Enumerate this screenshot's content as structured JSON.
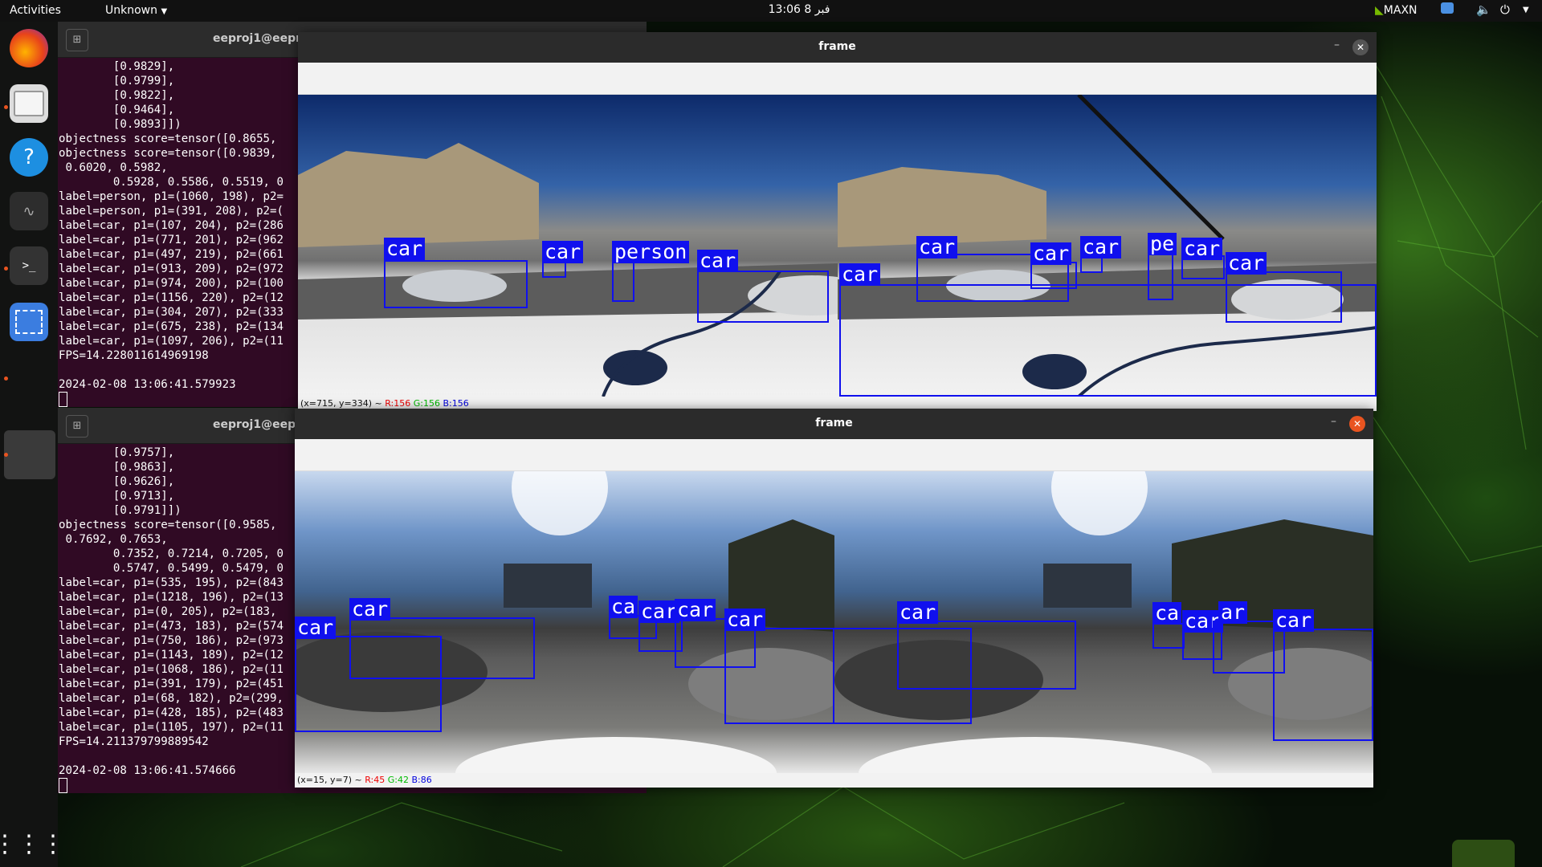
{
  "topbar": {
    "activities": "Activities",
    "app_menu": "Unknown",
    "clock": "13:06  فبر 8",
    "maxn": "MAXN",
    "icons": [
      "nvidia-icon",
      "network-icon",
      "volume-icon",
      "power-icon",
      "chevron-down-icon"
    ]
  },
  "dock": {
    "apps": [
      "firefox",
      "files",
      "help",
      "system-monitor",
      "terminal",
      "screenshot",
      "window",
      "show-apps"
    ]
  },
  "terminal_top": {
    "title": "eeproj1@eepro",
    "lines": [
      "        [0.9829],",
      "        [0.9799],",
      "        [0.9822],",
      "        [0.9464],",
      "        [0.9893]])",
      "objectness score=tensor([0.8655,",
      "objectness score=tensor([0.9839,",
      " 0.6020, 0.5982,",
      "        0.5928, 0.5586, 0.5519, 0",
      "label=person, p1=(1060, 198), p2=",
      "label=person, p1=(391, 208), p2=(",
      "label=car, p1=(107, 204), p2=(286",
      "label=car, p1=(771, 201), p2=(962",
      "label=car, p1=(497, 219), p2=(661",
      "label=car, p1=(913, 209), p2=(972",
      "label=car, p1=(974, 200), p2=(100",
      "label=car, p1=(1156, 220), p2=(12",
      "label=car, p1=(304, 207), p2=(333",
      "label=car, p1=(675, 238), p2=(134",
      "label=car, p1=(1097, 206), p2=(11",
      "FPS=14.228011614969198",
      "",
      "2024-02-08 13:06:41.579923"
    ]
  },
  "terminal_bottom": {
    "title": "eeproj1@eepr",
    "lines": [
      "        [0.9757],",
      "        [0.9863],",
      "        [0.9626],",
      "        [0.9713],",
      "        [0.9791]])",
      "objectness score=tensor([0.9585,",
      " 0.7692, 0.7653,",
      "        0.7352, 0.7214, 0.7205, 0",
      "        0.5747, 0.5499, 0.5479, 0",
      "label=car, p1=(535, 195), p2=(843",
      "label=car, p1=(1218, 196), p2=(13",
      "label=car, p1=(0, 205), p2=(183,",
      "label=car, p1=(473, 183), p2=(574",
      "label=car, p1=(750, 186), p2=(973",
      "label=car, p1=(1143, 189), p2=(12",
      "label=car, p1=(1068, 186), p2=(11",
      "label=car, p1=(391, 179), p2=(451",
      "label=car, p1=(68, 182), p2=(299,",
      "label=car, p1=(428, 185), p2=(483",
      "label=car, p1=(1105, 197), p2=(11",
      "FPS=14.211379799889542",
      "",
      "2024-02-08 13:06:41.574666"
    ]
  },
  "frame_top": {
    "title": "frame",
    "status_pos": "(x=715, y=334) ~ ",
    "status_r": "R:156",
    "status_g": "G:156",
    "status_b": "B:156",
    "detections_left": [
      "car",
      "car",
      "person",
      "car"
    ],
    "detections_right": [
      "car",
      "car",
      "car",
      "car",
      "pe",
      "car",
      "car"
    ]
  },
  "frame_bottom": {
    "title": "frame",
    "status_pos": "(x=15, y=7) ~ ",
    "status_r": "R:45",
    "status_g": "G:42",
    "status_b": "B:86",
    "detections_left": [
      "car",
      "car",
      "ca",
      "car",
      "car",
      "car"
    ],
    "detections_right": [
      "car",
      "ca",
      "car",
      "ar",
      "car"
    ]
  },
  "colors": {
    "detection_box": "#1010ee",
    "terminal_bg": "#300a24",
    "close_active": "#e95420"
  }
}
